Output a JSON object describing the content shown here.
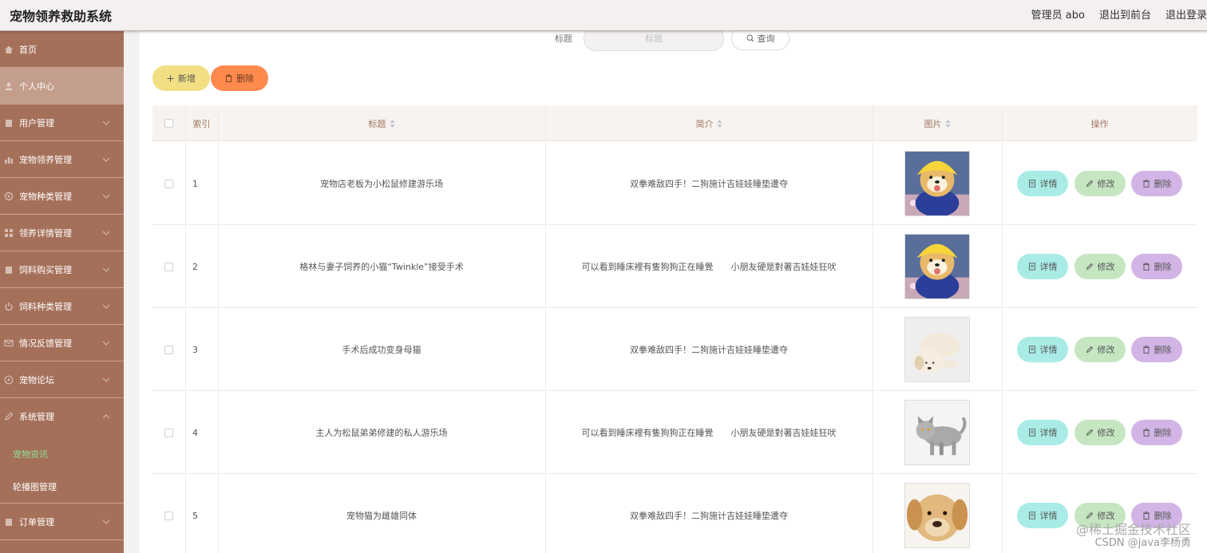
{
  "header": {
    "app_title": "宠物领养救助系统",
    "user_label": "管理员 abo",
    "to_front": "退出到前台",
    "logout": "退出登录"
  },
  "sidebar": {
    "items": [
      {
        "label": "首页",
        "icon": "home-icon"
      },
      {
        "label": "个人中心",
        "icon": "user-icon"
      },
      {
        "label": "用户管理",
        "icon": "clipboard-icon"
      },
      {
        "label": "宠物领养管理",
        "icon": "bar-chart-icon"
      },
      {
        "label": "宠物种类管理",
        "icon": "gear-icon"
      },
      {
        "label": "领养详情管理",
        "icon": "grid-icon"
      },
      {
        "label": "饲料购买管理",
        "icon": "clipboard-icon"
      },
      {
        "label": "饲料种类管理",
        "icon": "power-icon"
      },
      {
        "label": "情况反馈管理",
        "icon": "mail-icon"
      },
      {
        "label": "宠物论坛",
        "icon": "compass-icon"
      },
      {
        "label": "系统管理",
        "icon": "edit-icon"
      }
    ],
    "submenu": [
      {
        "label": "宠物资讯"
      },
      {
        "label": "轮播图管理"
      }
    ],
    "last_item": {
      "label": "订单管理",
      "icon": "clipboard-icon"
    }
  },
  "search": {
    "label": "标题",
    "placeholder": "标题",
    "button": "查询"
  },
  "toolbar": {
    "add": "新增",
    "delete": "删除"
  },
  "table": {
    "columns": {
      "index": "索引",
      "title": "标题",
      "summary": "简介",
      "image": "图片",
      "actions": "操作"
    },
    "rows": [
      {
        "index": "1",
        "title": "宠物店老板为小松鼠修建游乐场",
        "summary": "双拳难敌四手！二狗施计吉娃娃睡垫遭夺",
        "image": "shiba-dog"
      },
      {
        "index": "2",
        "title": "格林与妻子饲养的小猫“Twinkle”接受手术",
        "summary": "可以看到睡床裡有隻狗狗正在睡覺　　小朋友硬是對著吉娃娃狂吠",
        "image": "shiba-dog"
      },
      {
        "index": "3",
        "title": "手术后成功变身母猫",
        "summary": "双拳难敌四手！二狗施计吉娃娃睡垫遭夺",
        "image": "white-puppy"
      },
      {
        "index": "4",
        "title": "主人为松鼠弟弟修建的私人游乐场",
        "summary": "可以看到睡床裡有隻狗狗正在睡覺　　小朋友硬是對著吉娃娃狂吠",
        "image": "gray-cat"
      },
      {
        "index": "5",
        "title": "宠物猫为雌雄同体",
        "summary": "双拳难敌四手！二狗施计吉娃娃睡垫遭夺",
        "image": "golden-puppy"
      }
    ],
    "row_actions": {
      "detail": "详情",
      "edit": "修改",
      "delete": "删除"
    }
  },
  "watermark": {
    "line1": "@稀土掘金技术社区",
    "line2": "CSDN @java李杨勇"
  },
  "colors": {
    "sidebar_bg": "#a5705a",
    "add_button": "#f2df84",
    "delete_button": "#ff8a4d",
    "detail_button": "#a9ece6",
    "edit_button": "#c6e6c2",
    "row_delete_button": "#d2b5e6"
  }
}
